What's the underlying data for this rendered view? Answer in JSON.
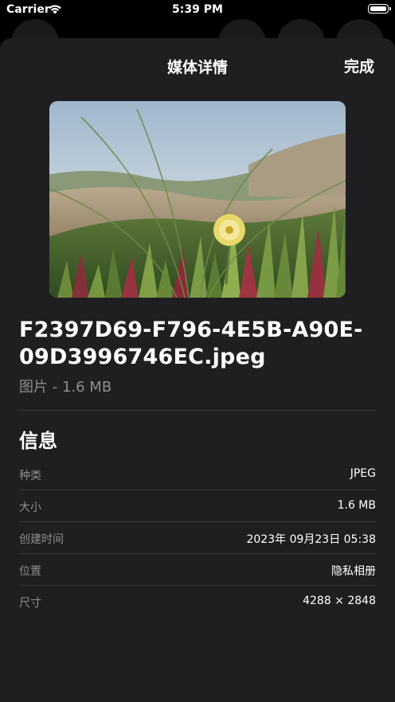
{
  "status_bar": {
    "carrier": "Carrier",
    "time": "5:39 PM"
  },
  "header": {
    "title": "媒体详情",
    "done_label": "完成"
  },
  "media": {
    "file_name": "F2397D69-F796-4E5B-A90E-09D3996746EC.jpeg",
    "subtitle": "图片 - 1.6 MB"
  },
  "info": {
    "title": "信息",
    "rows": [
      {
        "label": "种类",
        "value": "JPEG"
      },
      {
        "label": "大小",
        "value": "1.6 MB"
      },
      {
        "label": "创建时间",
        "value": "2023年 09月23日 05:38"
      },
      {
        "label": "位置",
        "value": "隐私相册"
      },
      {
        "label": "尺寸",
        "value": "4288 × 2848"
      }
    ]
  },
  "colors": {
    "sheet_background": "#1f1f21",
    "secondary_text": "#8d8d92",
    "divider": "#38383b"
  }
}
